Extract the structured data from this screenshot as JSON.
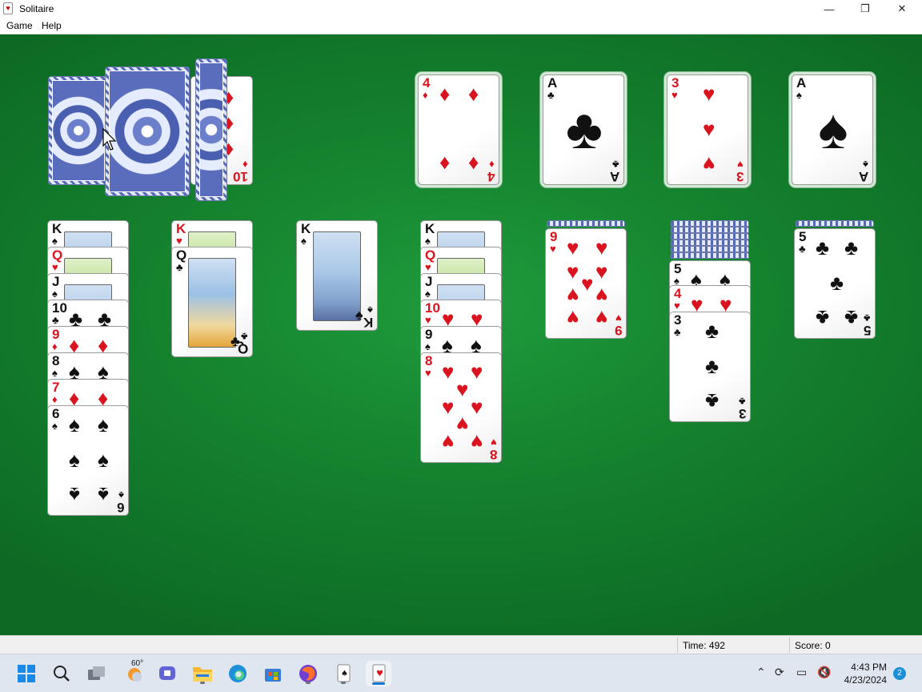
{
  "window": {
    "title": "Solitaire",
    "minimize_glyph": "—",
    "maximize_glyph": "❐",
    "close_glyph": "✕"
  },
  "menu": {
    "game_label": "Game",
    "help_label": "Help"
  },
  "status": {
    "time_label": "Time:  492",
    "score_label": "Score: 0"
  },
  "game": {
    "stock": {
      "icon": "card-back-deck",
      "cards_visible": 3
    },
    "waste_top": {
      "rank": "10",
      "suit": "♦"
    },
    "foundations": [
      {
        "rank": "4",
        "suit": "♦"
      },
      {
        "rank": "A",
        "suit": "♣"
      },
      {
        "rank": "3",
        "suit": "♥"
      },
      {
        "rank": "A",
        "suit": "♠"
      }
    ],
    "tableau": [
      {
        "hidden": 0,
        "cards": [
          {
            "rank": "K",
            "suit": "♠"
          },
          {
            "rank": "Q",
            "suit": "♥"
          },
          {
            "rank": "J",
            "suit": "♠"
          },
          {
            "rank": "10",
            "suit": "♣"
          },
          {
            "rank": "9",
            "suit": "♦"
          },
          {
            "rank": "8",
            "suit": "♠"
          },
          {
            "rank": "7",
            "suit": "♦"
          },
          {
            "rank": "6",
            "suit": "♠"
          }
        ]
      },
      {
        "hidden": 0,
        "cards": [
          {
            "rank": "K",
            "suit": "♥"
          },
          {
            "rank": "Q",
            "suit": "♣"
          }
        ]
      },
      {
        "hidden": 0,
        "cards": [
          {
            "rank": "K",
            "suit": "♠"
          }
        ]
      },
      {
        "hidden": 0,
        "cards": [
          {
            "rank": "K",
            "suit": "♠"
          },
          {
            "rank": "Q",
            "suit": "♥"
          },
          {
            "rank": "J",
            "suit": "♠"
          },
          {
            "rank": "10",
            "suit": "♥"
          },
          {
            "rank": "9",
            "suit": "♠"
          },
          {
            "rank": "8",
            "suit": "♥"
          }
        ]
      },
      {
        "hidden": 1,
        "cards": [
          {
            "rank": "9",
            "suit": "♥"
          }
        ]
      },
      {
        "hidden": 6,
        "cards": [
          {
            "rank": "5",
            "suit": "♠"
          },
          {
            "rank": "4",
            "suit": "♥"
          },
          {
            "rank": "3",
            "suit": "♣"
          }
        ]
      },
      {
        "hidden": 1,
        "cards": [
          {
            "rank": "5",
            "suit": "♣"
          }
        ]
      }
    ]
  },
  "taskbar": {
    "weather_temp": "60°",
    "time": "4:43 PM",
    "date": "4/23/2024",
    "notification_count": "2",
    "icons": [
      "start-icon",
      "search-icon",
      "task-view-icon",
      "weather-icon",
      "teams-chat-icon",
      "file-explorer-icon",
      "edge-icon",
      "store-icon",
      "firefox-icon",
      "solitaire-icon",
      "solitaire-active-icon"
    ]
  },
  "colors": {
    "felt": "#15832f",
    "red_suit": "#d9141e",
    "black_suit": "#111111",
    "taskbar": "#dfe6ef",
    "accent": "#1478d4"
  }
}
